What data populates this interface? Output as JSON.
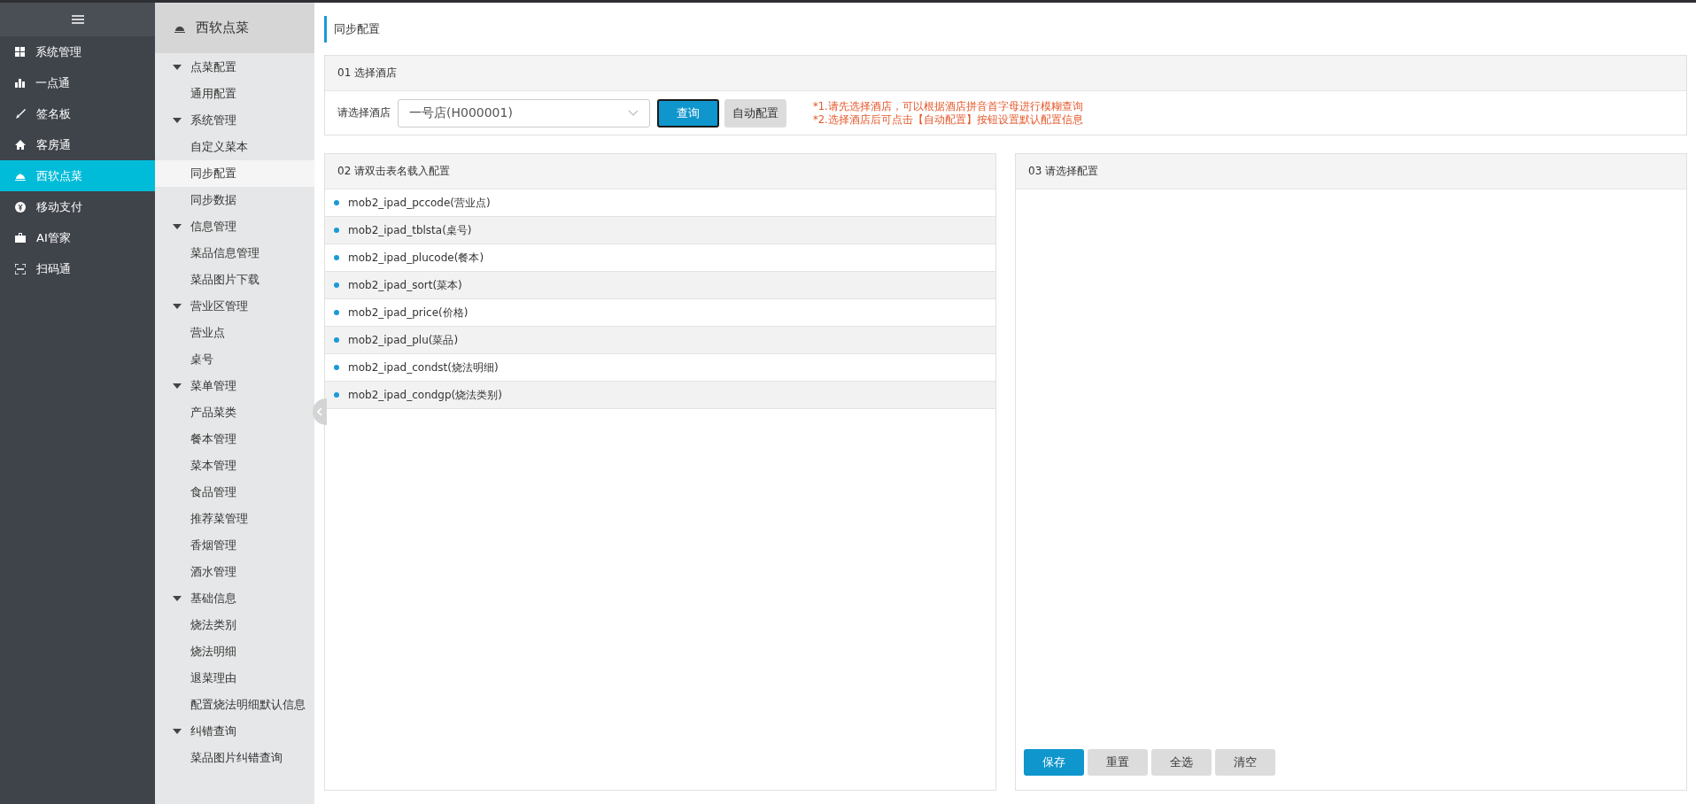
{
  "nav": {
    "items": [
      {
        "label": "系统管理",
        "selected": false
      },
      {
        "label": "一点通",
        "selected": false
      },
      {
        "label": "签名板",
        "selected": false
      },
      {
        "label": "客房通",
        "selected": false
      },
      {
        "label": "西软点菜",
        "selected": true
      },
      {
        "label": "移动支付",
        "selected": false
      },
      {
        "label": "AI管家",
        "selected": false
      },
      {
        "label": "扫码通",
        "selected": false
      }
    ]
  },
  "submenu": {
    "title": "西软点菜",
    "groups": [
      {
        "label": "点菜配置",
        "expanded": true,
        "children": [
          {
            "label": "通用配置",
            "selected": false
          }
        ]
      },
      {
        "label": "系统管理",
        "expanded": true,
        "children": [
          {
            "label": "自定义菜本",
            "selected": false
          },
          {
            "label": "同步配置",
            "selected": true
          },
          {
            "label": "同步数据",
            "selected": false
          }
        ]
      },
      {
        "label": "信息管理",
        "expanded": true,
        "children": [
          {
            "label": "菜品信息管理",
            "selected": false
          },
          {
            "label": "菜品图片下载",
            "selected": false
          }
        ]
      },
      {
        "label": "营业区管理",
        "expanded": true,
        "children": [
          {
            "label": "营业点",
            "selected": false
          },
          {
            "label": "桌号",
            "selected": false
          }
        ]
      },
      {
        "label": "菜单管理",
        "expanded": true,
        "children": [
          {
            "label": "产品菜类",
            "selected": false
          },
          {
            "label": "餐本管理",
            "selected": false
          },
          {
            "label": "菜本管理",
            "selected": false
          },
          {
            "label": "食品管理",
            "selected": false
          },
          {
            "label": "推荐菜管理",
            "selected": false
          },
          {
            "label": "香烟管理",
            "selected": false
          },
          {
            "label": "酒水管理",
            "selected": false
          }
        ]
      },
      {
        "label": "基础信息",
        "expanded": true,
        "children": [
          {
            "label": "烧法类别",
            "selected": false
          },
          {
            "label": "烧法明细",
            "selected": false
          },
          {
            "label": "退菜理由",
            "selected": false
          },
          {
            "label": "配置烧法明细默认信息",
            "selected": false
          }
        ]
      },
      {
        "label": "纠错查询",
        "expanded": true,
        "children": [
          {
            "label": "菜品图片纠错查询",
            "selected": false
          }
        ]
      }
    ]
  },
  "page_title": "同步配置",
  "hotel_panel": {
    "title": "01 选择酒店",
    "field_label": "请选择酒店",
    "select_value": "一号店(H000001)",
    "buttons": [
      {
        "label": "查询",
        "kind": "primary"
      },
      {
        "label": "自动配置",
        "kind": "default"
      }
    ],
    "notes": [
      "*1.请先选择酒店，可以根据酒店拼音首字母进行模糊查询",
      "*2.选择酒店后可点击【自动配置】按钮设置默认配置信息"
    ]
  },
  "tables_panel": {
    "title": "02 请双击表名载入配置",
    "rows": [
      "mob2_ipad_pccode(营业点)",
      "mob2_ipad_tblsta(桌号)",
      "mob2_ipad_plucode(餐本)",
      "mob2_ipad_sort(菜本)",
      "mob2_ipad_price(价格)",
      "mob2_ipad_plu(菜品)",
      "mob2_ipad_condst(烧法明细)",
      "mob2_ipad_condgp(烧法类别)"
    ]
  },
  "config_panel": {
    "title": "03 请选择配置",
    "buttons": [
      {
        "label": "保存",
        "kind": "primary"
      },
      {
        "label": "重置",
        "kind": "default"
      },
      {
        "label": "全选",
        "kind": "default"
      },
      {
        "label": "清空",
        "kind": "default"
      }
    ]
  }
}
